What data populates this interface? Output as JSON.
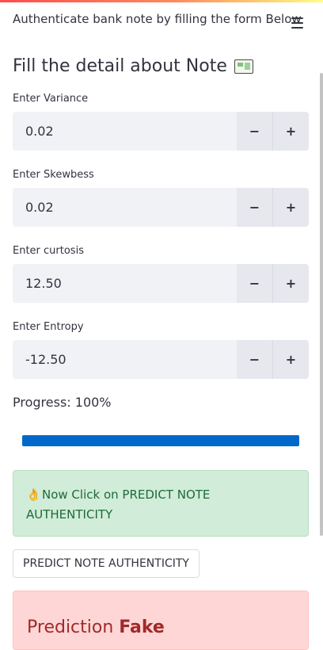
{
  "header": {
    "title": "Authenticate bank note by filling the form Below",
    "menu_icon": "hamburger-menu-icon"
  },
  "form": {
    "title": "Fill the detail about Note",
    "title_icon": "money-note-icon",
    "fields": [
      {
        "label": "Enter Variance",
        "value": "0.02"
      },
      {
        "label": "Enter Skewbess",
        "value": "0.02"
      },
      {
        "label": "Enter curtosis",
        "value": "12.50"
      },
      {
        "label": "Enter Entropy",
        "value": "-12.50"
      }
    ],
    "minus_label": "−",
    "plus_label": "+"
  },
  "progress": {
    "text": "Progress: 100%",
    "value": 100,
    "color": "#0068c9"
  },
  "success": {
    "icon": "ok-hand-icon",
    "icon_glyph": "👌",
    "text": "Now Click on PREDICT NOTE AUTHENTICITY",
    "color": "#d1ecd9"
  },
  "predict_button": {
    "label": "PREDICT NOTE AUTHENTICITY"
  },
  "result": {
    "prefix": "Prediction",
    "value": "Fake",
    "color": "#ffd6d6"
  }
}
